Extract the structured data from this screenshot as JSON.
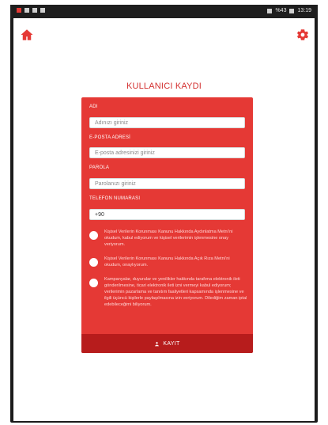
{
  "status_bar": {
    "time": "13:19",
    "battery": "%43"
  },
  "header": {
    "title": "KULLANICI KAYDI"
  },
  "form": {
    "name_label": "ADI",
    "name_placeholder": "Adınızı giriniz",
    "email_label": "E-POSTA ADRESİ",
    "email_placeholder": "E-posta adresinizi giriniz",
    "password_label": "PAROLA",
    "password_placeholder": "Parolanızı giriniz",
    "phone_label": "TELEFON NUMARASI",
    "phone_value": "+90"
  },
  "checkboxes": [
    {
      "text": "Kişisel Verilerin Korunması Kanunu Hakkında Aydınlatma Metni’ni okudum, kabul ediyorum ve kişisel verilerimin işlenmesine onay veriyorum."
    },
    {
      "text": "Kişisel Verilerin Korunması Kanunu Hakkında Açık Rıza Metni’ni okudum, onaylıyorum."
    },
    {
      "text": "Kampanyalar, duyurular ve yenilikler hakkında tarafıma elektronik ileti gönderilmesine, ticari elektronik ileti izni vermeyi kabul ediyorum; verilerimin pazarlama ve tanıtım faaliyetleri kapsamında işlenmesine ve ilgili üçüncü kişilerle paylaşılmasına izin veriyorum. Dilediğim zaman iptal edebileceğimi biliyorum."
    }
  ],
  "submit": {
    "label": "KAYIT"
  },
  "colors": {
    "accent": "#e53935",
    "accent_dark": "#b71c1c"
  },
  "icons": {
    "top_left": "home-icon",
    "top_right": "gear-icon",
    "submit": "user-icon"
  }
}
